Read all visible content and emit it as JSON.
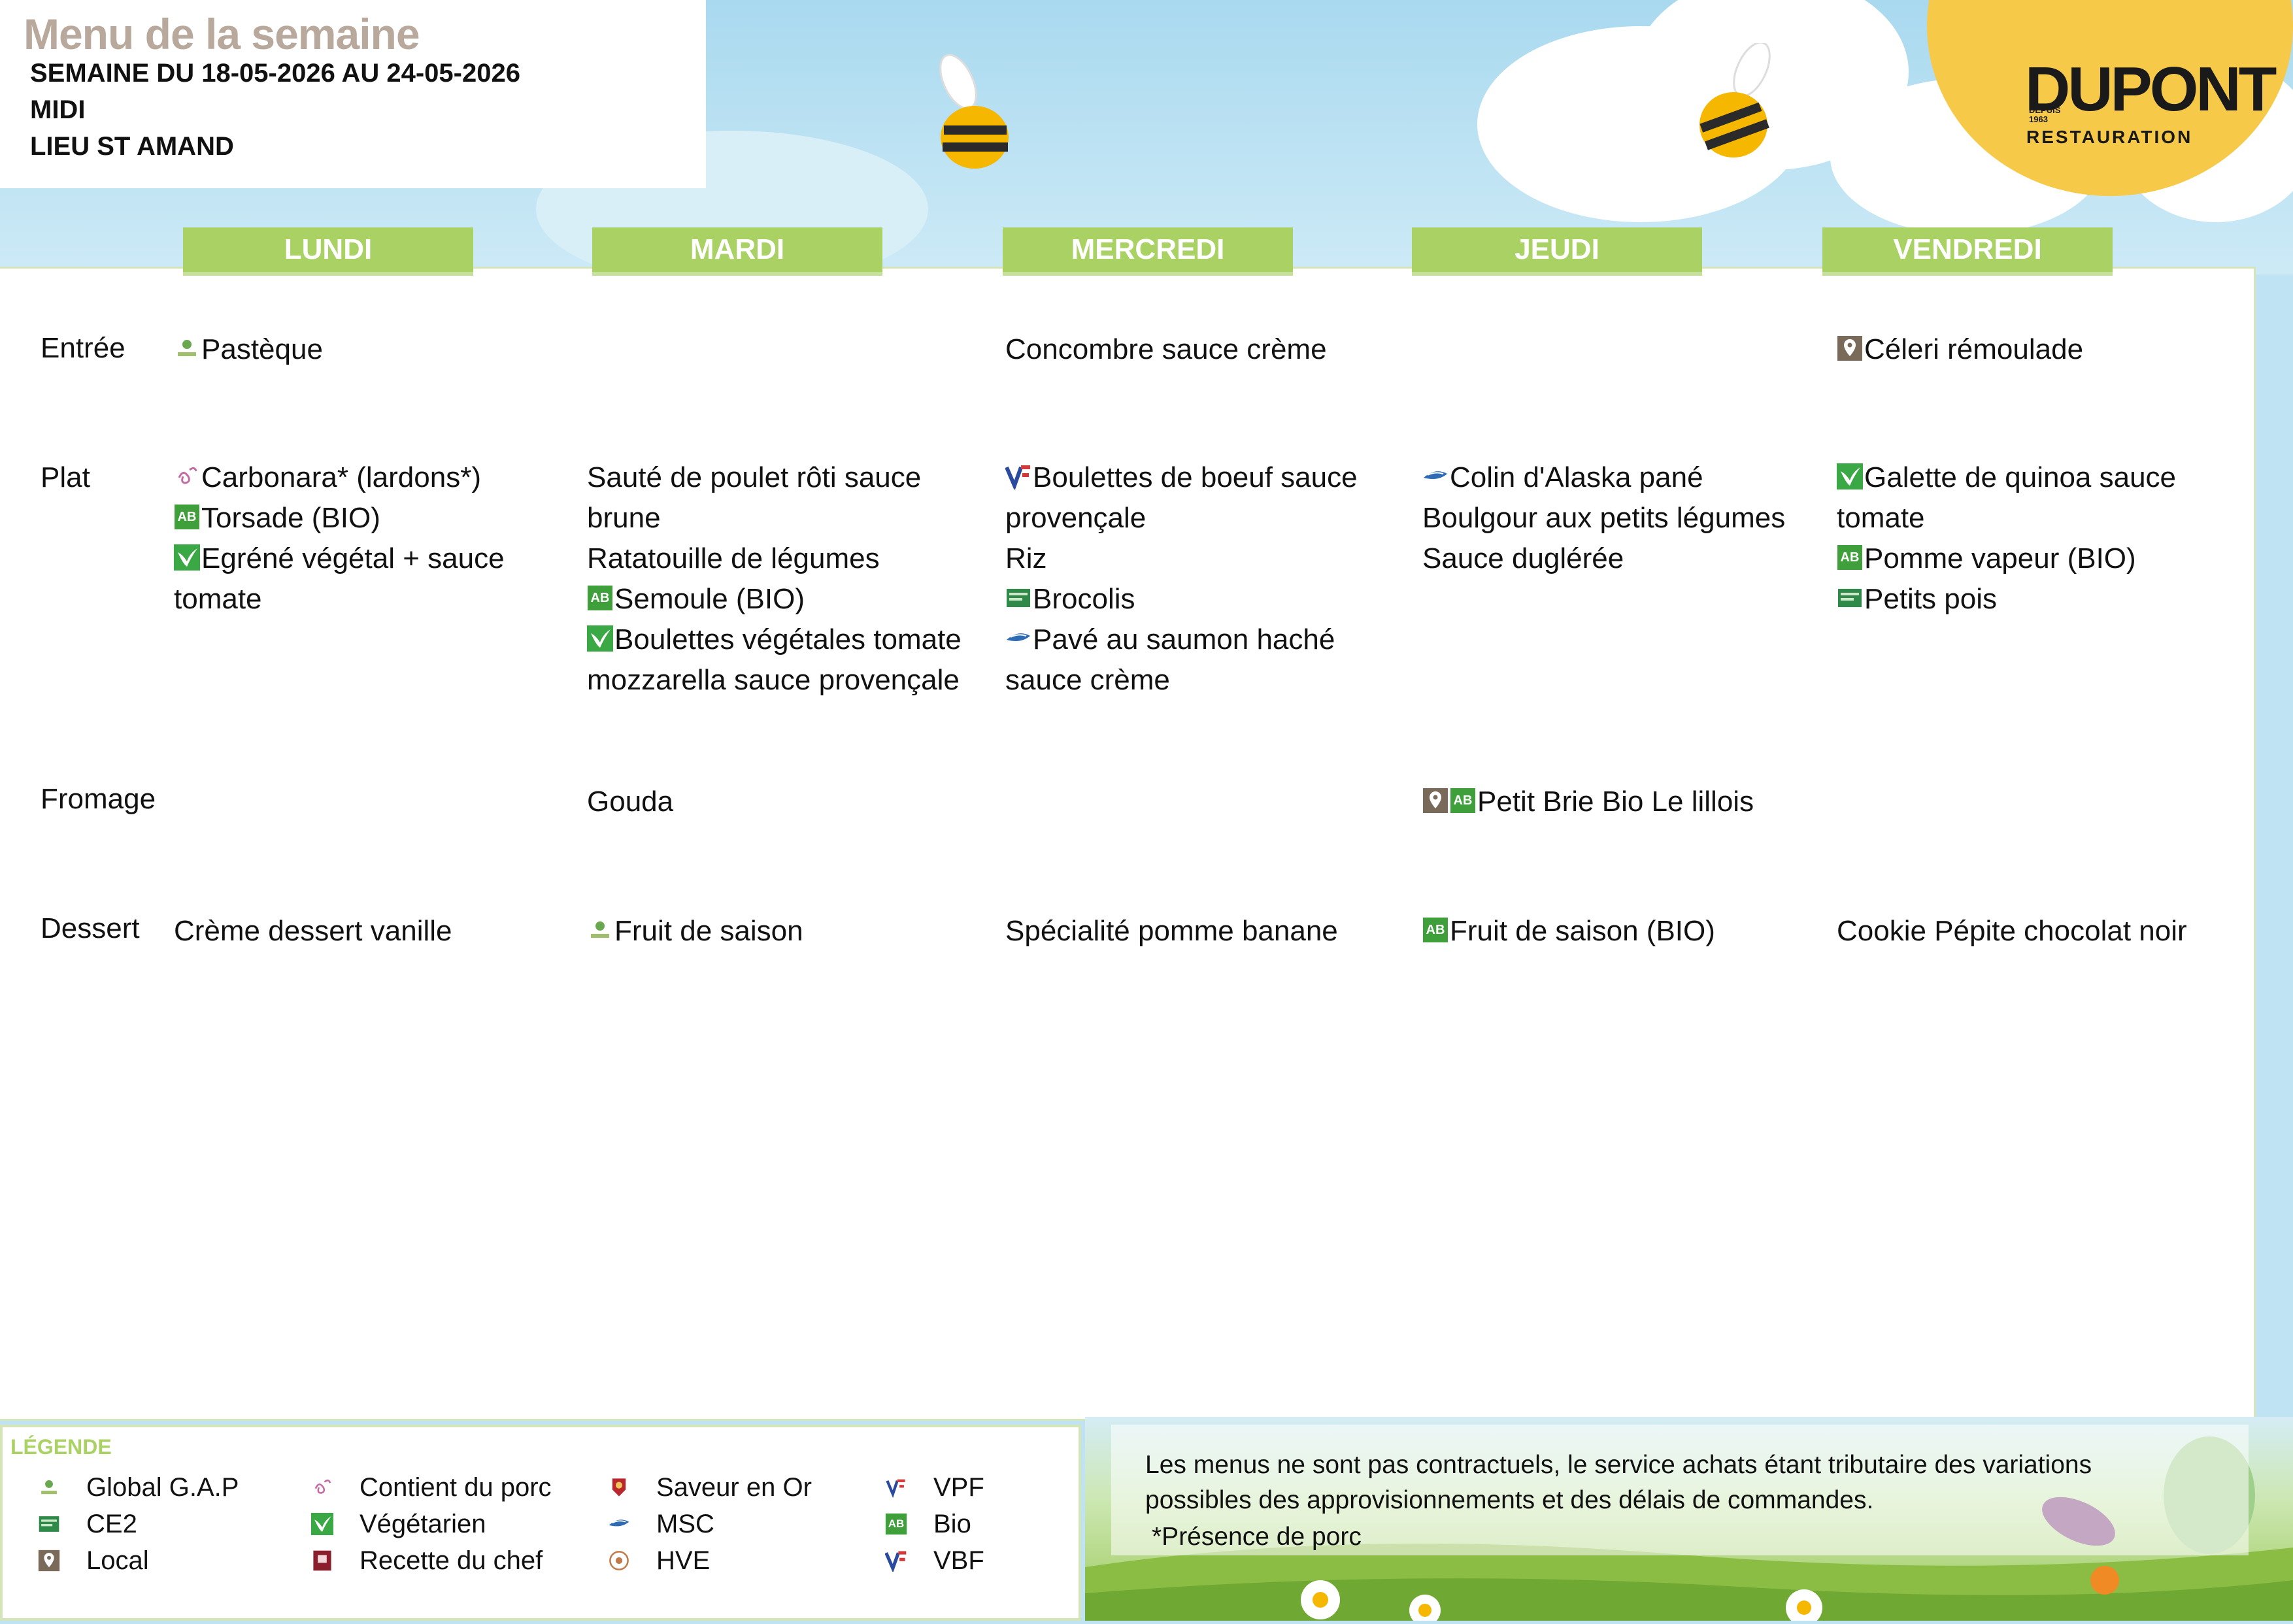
{
  "header": {
    "title": "Menu de la semaine",
    "week": "SEMAINE DU 18-05-2026 AU 24-05-2026",
    "service": "MIDI",
    "location": "LIEU ST AMAND"
  },
  "logo": {
    "brand": "DUPONT",
    "since": "DEPUIS 1963",
    "subtitle": "RESTAURATION"
  },
  "days": [
    "LUNDI",
    "MARDI",
    "MERCREDI",
    "JEUDI",
    "VENDREDI"
  ],
  "courses": [
    "Entrée",
    "Plat",
    "Fromage",
    "Dessert"
  ],
  "menu": {
    "entree": {
      "lundi": [
        {
          "icons": [
            "globalgap"
          ],
          "text": "Pastèque"
        }
      ],
      "mardi": [],
      "mercredi": [
        {
          "icons": [],
          "text": "Concombre sauce crème"
        }
      ],
      "jeudi": [],
      "vendredi": [
        {
          "icons": [
            "local"
          ],
          "text": "Céleri rémoulade"
        }
      ]
    },
    "plat": {
      "lundi": [
        {
          "icons": [
            "porc"
          ],
          "text": "Carbonara* (lardons*)"
        },
        {
          "icons": [
            "bio"
          ],
          "text": "Torsade (BIO)"
        },
        {
          "icons": [
            "vege"
          ],
          "text": "Egréné végétal + sauce tomate"
        }
      ],
      "mardi": [
        {
          "icons": [],
          "text": "Sauté de poulet rôti sauce brune"
        },
        {
          "icons": [],
          "text": "Ratatouille de légumes"
        },
        {
          "icons": [
            "bio"
          ],
          "text": "Semoule (BIO)"
        },
        {
          "icons": [
            "vege"
          ],
          "text": "Boulettes végétales tomate mozzarella sauce provençale"
        }
      ],
      "mercredi": [
        {
          "icons": [
            "vbf"
          ],
          "text": "Boulettes de boeuf sauce provençale"
        },
        {
          "icons": [],
          "text": "Riz"
        },
        {
          "icons": [
            "ce2"
          ],
          "text": "Brocolis"
        },
        {
          "icons": [
            "msc"
          ],
          "text": "Pavé au saumon haché sauce crème"
        }
      ],
      "jeudi": [
        {
          "icons": [
            "msc"
          ],
          "text": "Colin d'Alaska pané"
        },
        {
          "icons": [],
          "text": "Boulgour aux petits légumes"
        },
        {
          "icons": [],
          "text": "Sauce duglérée"
        }
      ],
      "vendredi": [
        {
          "icons": [
            "vege"
          ],
          "text": "Galette de quinoa sauce tomate"
        },
        {
          "icons": [
            "bio"
          ],
          "text": "Pomme vapeur (BIO)"
        },
        {
          "icons": [
            "ce2"
          ],
          "text": "Petits pois"
        }
      ]
    },
    "fromage": {
      "lundi": [],
      "mardi": [
        {
          "icons": [],
          "text": "Gouda"
        }
      ],
      "mercredi": [],
      "jeudi": [
        {
          "icons": [
            "local",
            "bio"
          ],
          "text": "Petit Brie Bio Le lillois"
        }
      ],
      "vendredi": []
    },
    "dessert": {
      "lundi": [
        {
          "icons": [],
          "text": "Crème dessert vanille"
        }
      ],
      "mardi": [
        {
          "icons": [
            "globalgap"
          ],
          "text": "Fruit de saison"
        }
      ],
      "mercredi": [
        {
          "icons": [],
          "text": "Spécialité pomme banane"
        }
      ],
      "jeudi": [
        {
          "icons": [
            "bio"
          ],
          "text": "Fruit de saison (BIO)"
        }
      ],
      "vendredi": [
        {
          "icons": [],
          "text": "Cookie Pépite chocolat noir"
        }
      ]
    }
  },
  "legend": {
    "title": "LÉGENDE",
    "items": [
      {
        "icon": "globalgap",
        "label": "Global G.A.P"
      },
      {
        "icon": "ce2",
        "label": "CE2"
      },
      {
        "icon": "local",
        "label": "Local"
      },
      {
        "icon": "porc",
        "label": "Contient du porc"
      },
      {
        "icon": "vege",
        "label": "Végétarien"
      },
      {
        "icon": "chef",
        "label": "Recette du chef"
      },
      {
        "icon": "saveur",
        "label": "Saveur en Or"
      },
      {
        "icon": "msc",
        "label": "MSC"
      },
      {
        "icon": "hve",
        "label": "HVE"
      },
      {
        "icon": "vpf",
        "label": "VPF"
      },
      {
        "icon": "bio",
        "label": "Bio"
      },
      {
        "icon": "vbf",
        "label": "VBF"
      }
    ]
  },
  "footer": {
    "note_line1": "Les menus ne sont pas contractuels, le service achats étant tributaire des variations",
    "note_line2": "possibles des approvisionnements et des délais de commandes.",
    "note_line3": "*Présence de porc"
  },
  "colors": {
    "tab_green": "#a9d163",
    "title_taupe": "#b8a99c",
    "sky": "#a9d9ef",
    "sun": "#f7c948"
  }
}
